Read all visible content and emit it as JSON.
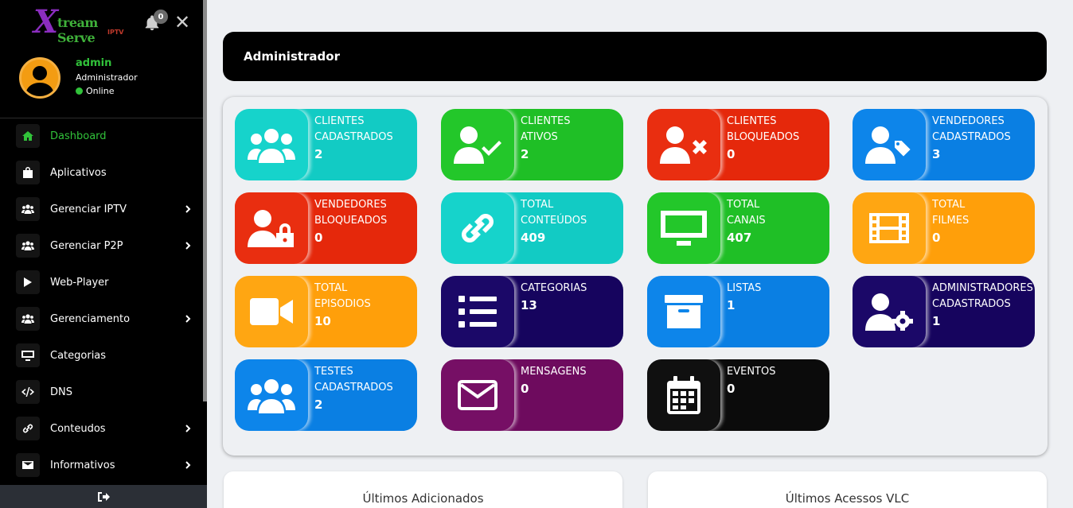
{
  "brand": {
    "x": "X",
    "name": "tream Serve",
    "sub": "IPTV"
  },
  "notifications": {
    "count": "0"
  },
  "user": {
    "name": "admin",
    "role": "Administrador",
    "status": "Online"
  },
  "menu": [
    {
      "label": "Dashboard",
      "icon": "home-icon",
      "active": true,
      "has_submenu": false
    },
    {
      "label": "Aplicativos",
      "icon": "bag-icon",
      "active": false,
      "has_submenu": false
    },
    {
      "label": "Gerenciar IPTV",
      "icon": "users-icon",
      "active": false,
      "has_submenu": true
    },
    {
      "label": "Gerenciar P2P",
      "icon": "users-icon",
      "active": false,
      "has_submenu": true
    },
    {
      "label": "Web-Player",
      "icon": "play-icon",
      "active": false,
      "has_submenu": false
    },
    {
      "label": "Gerenciamento",
      "icon": "users-icon",
      "active": false,
      "has_submenu": true
    },
    {
      "label": "Categorias",
      "icon": "monitor-icon",
      "active": false,
      "has_submenu": false
    },
    {
      "label": "DNS",
      "icon": "code-icon",
      "active": false,
      "has_submenu": false
    },
    {
      "label": "Conteudos",
      "icon": "link-icon",
      "active": false,
      "has_submenu": true
    },
    {
      "label": "Informativos",
      "icon": "envelope-icon",
      "active": false,
      "has_submenu": true
    }
  ],
  "header": {
    "title": "Administrador"
  },
  "cards": [
    {
      "line1": "Clientes",
      "line2": "Cadastrados",
      "value": "2",
      "icon": "users-icon",
      "color": "#12cbc4",
      "iconColor": "#16d3cb"
    },
    {
      "line1": "Clientes",
      "line2": "Ativos",
      "value": "2",
      "icon": "user-check-icon",
      "color": "#1fbf26",
      "iconColor": "#23c72a"
    },
    {
      "line1": "Clientes",
      "line2": "Bloqueados",
      "value": "0",
      "icon": "user-times-icon",
      "color": "#e5280b",
      "iconColor": "#e92e10"
    },
    {
      "line1": "Vendedores",
      "line2": "Cadastrados",
      "value": "3",
      "icon": "user-tag-icon",
      "color": "#0a7fe3",
      "iconColor": "#0d85ea"
    },
    {
      "line1": "Vendedores",
      "line2": "Bloqueados",
      "value": "0",
      "icon": "user-lock-icon",
      "color": "#e5280b",
      "iconColor": "#e92e10"
    },
    {
      "line1": "Total",
      "line2": "Conteúdos",
      "value": "409",
      "icon": "link-icon",
      "color": "#12cbc4",
      "iconColor": "#16d3cb"
    },
    {
      "line1": "Total",
      "line2": "Canais",
      "value": "407",
      "icon": "monitor-icon",
      "color": "#1fbf26",
      "iconColor": "#23c72a"
    },
    {
      "line1": "Total",
      "line2": "Filmes",
      "value": "0",
      "icon": "film-icon",
      "color": "#ff9f0a",
      "iconColor": "#ffa612"
    },
    {
      "line1": "Total",
      "line2": "Episodios",
      "value": "10",
      "icon": "video-icon",
      "color": "#ff9f0a",
      "iconColor": "#ffa612"
    },
    {
      "line1": "Categorias",
      "line2": "",
      "value": "13",
      "icon": "list-icon",
      "color": "#16045e",
      "iconColor": "#1b0868"
    },
    {
      "line1": "Listas",
      "line2": "",
      "value": "1",
      "icon": "archive-icon",
      "color": "#0a7fe3",
      "iconColor": "#0d85ea"
    },
    {
      "line1": "Administradores",
      "line2": "Cadastrados",
      "value": "1",
      "icon": "user-cog-icon",
      "color": "#16045e",
      "iconColor": "#1b0868"
    },
    {
      "line1": "Testes",
      "line2": "Cadastrados",
      "value": "2",
      "icon": "users-icon",
      "color": "#0a7fe3",
      "iconColor": "#0d85ea"
    },
    {
      "line1": "Mensagens",
      "line2": "",
      "value": "0",
      "icon": "envelope-icon",
      "color": "#6e0b5e",
      "iconColor": "#760f65"
    },
    {
      "line1": "Eventos",
      "line2": "",
      "value": "0",
      "icon": "calendar-icon",
      "color": "#0b0b0b",
      "iconColor": "#101010"
    }
  ],
  "panels": {
    "left_title": "Últimos Adicionados",
    "right_title": "Últimos Acessos VLC"
  }
}
